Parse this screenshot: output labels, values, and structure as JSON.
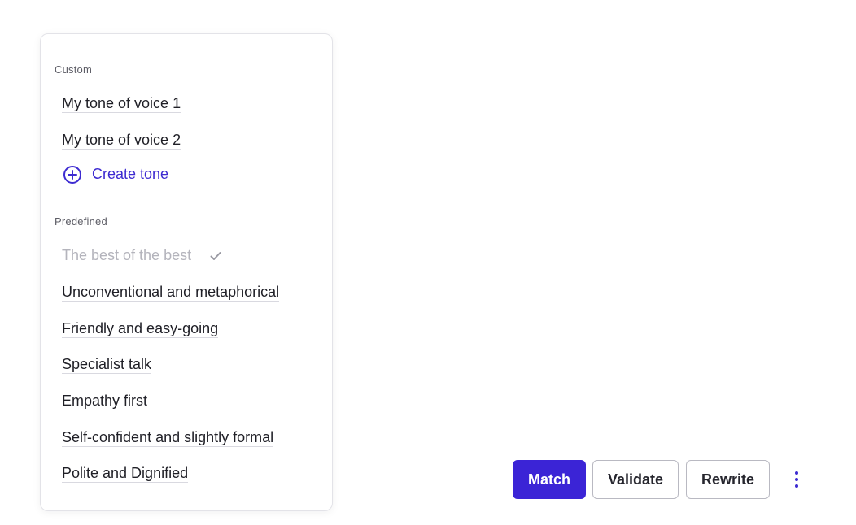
{
  "dropdown": {
    "custom_label": "Custom",
    "custom_items": [
      "My tone of voice 1",
      "My tone of voice 2"
    ],
    "create_label": "Create tone",
    "predefined_label": "Predefined",
    "predefined_selected": "The best of the best",
    "predefined_items": [
      "Unconventional and metaphorical",
      "Friendly and easy-going",
      "Specialist talk",
      "Empathy first",
      "Self-confident and slightly formal",
      "Polite and Dignified"
    ]
  },
  "actions": {
    "match_label": "Match",
    "validate_label": "Validate",
    "rewrite_label": "Rewrite",
    "more_icon": "more-vertical-icon"
  },
  "colors": {
    "accent": "#3b24d6",
    "link": "#3d2bd1",
    "disabled_text": "#b4b4bc"
  }
}
